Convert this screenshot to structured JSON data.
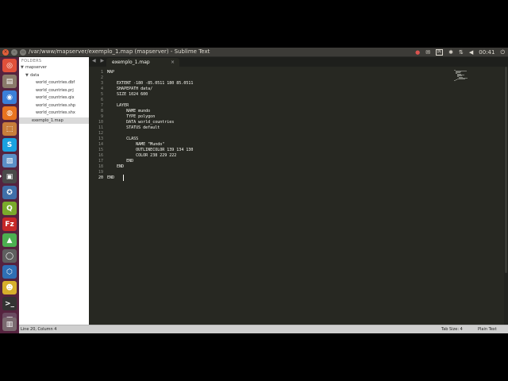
{
  "window": {
    "title": "/var/www/mapserver/exemplo_1.map (mapserver) - Sublime Text",
    "close_glyph": "×",
    "min_glyph": "–",
    "max_glyph": "▫"
  },
  "tray": {
    "items": [
      {
        "name": "record-icon",
        "glyph": "●"
      },
      {
        "name": "mail-icon",
        "glyph": "✉"
      },
      {
        "name": "keyboard-layout-indicator",
        "glyph": "Pt"
      },
      {
        "name": "bluetooth-icon",
        "glyph": "✱"
      },
      {
        "name": "network-icon",
        "glyph": "⇅"
      },
      {
        "name": "volume-icon",
        "glyph": "◀"
      }
    ],
    "clock": "00:41",
    "power_glyph": "⏻"
  },
  "launcher": {
    "items": [
      {
        "name": "dash-home-icon",
        "glyph": "◎",
        "color": "#e0503a"
      },
      {
        "name": "files-icon",
        "glyph": "▤",
        "color": "#8a7a6a"
      },
      {
        "name": "chromium-icon",
        "glyph": "◉",
        "color": "#3b7fd8"
      },
      {
        "name": "firefox-icon",
        "glyph": "◍",
        "color": "#e8731f"
      },
      {
        "name": "software-center-icon",
        "glyph": "⬚",
        "color": "#c87d3b"
      },
      {
        "name": "skype-icon",
        "glyph": "S",
        "color": "#1aa1e0"
      },
      {
        "name": "image-viewer-icon",
        "glyph": "▧",
        "color": "#5b8fc7"
      },
      {
        "name": "sublime-text-icon",
        "glyph": "▣",
        "color": "#4a4a4a"
      },
      {
        "name": "pgadmin-icon",
        "glyph": "✪",
        "color": "#3f6fa8"
      },
      {
        "name": "qgis-icon",
        "glyph": "Q",
        "color": "#7aab2b"
      },
      {
        "name": "filezilla-icon",
        "glyph": "Fz",
        "color": "#c62828"
      },
      {
        "name": "android-studio-icon",
        "glyph": "▲",
        "color": "#4caf50"
      },
      {
        "name": "alarm-icon",
        "glyph": "◯",
        "color": "#5f5f5f"
      },
      {
        "name": "virtualbox-icon",
        "glyph": "⬡",
        "color": "#2f6fb4"
      },
      {
        "name": "tomboy-icon",
        "glyph": "☻",
        "color": "#d7b02c"
      },
      {
        "name": "terminal-icon",
        "glyph": ">_",
        "color": "#333333"
      },
      {
        "name": "workspace-switcher-icon",
        "glyph": "▦",
        "color": "#6a4a60"
      },
      {
        "name": "trash-icon",
        "glyph": "▥",
        "color": "#7a6a70"
      }
    ]
  },
  "sidebar": {
    "header": "FOLDERS",
    "tree": [
      {
        "name": "folder-mapserver",
        "label": "mapserver",
        "arrow": "▼",
        "indent": 1
      },
      {
        "name": "folder-data",
        "label": "data",
        "arrow": "▼",
        "indent": 2
      },
      {
        "name": "file-world-countries-dbf",
        "label": "world_countries.dbf",
        "arrow": "",
        "indent": 3
      },
      {
        "name": "file-world-countries-prj",
        "label": "world_countries.prj",
        "arrow": "",
        "indent": 3
      },
      {
        "name": "file-world-countries-qix",
        "label": "world_countries.qix",
        "arrow": "",
        "indent": 3
      },
      {
        "name": "file-world-countries-shp",
        "label": "world_countries.shp",
        "arrow": "",
        "indent": 3
      },
      {
        "name": "file-world-countries-shx",
        "label": "world_countries.shx",
        "arrow": "",
        "indent": 3
      },
      {
        "name": "file-exemplo-1-map",
        "label": "exemplo_1.map",
        "arrow": "",
        "indent": 2,
        "selected": true
      }
    ]
  },
  "editor": {
    "tab_nav": "◀ ▶",
    "tab_label": "exemplo_1.map",
    "tab_close": "×",
    "active_line": 20,
    "lines": [
      "MAP",
      "",
      "    EXTENT -180 -85.0511 180 85.0511",
      "    SHAPEPATH data/",
      "    SIZE 1024 600",
      "",
      "    LAYER",
      "        NAME mundo",
      "        TYPE polygon",
      "        DATA world_countries",
      "        STATUS default",
      "",
      "        CLASS",
      "            NAME \"Mundo\"",
      "            OUTLINECOLOR 139 134 130",
      "            COLOR 238 229 222",
      "        END",
      "    END",
      "",
      "END"
    ]
  },
  "status": {
    "position": "Line 20, Column 4",
    "tab_size": "Tab Size: 4",
    "syntax": "Plain Text"
  }
}
